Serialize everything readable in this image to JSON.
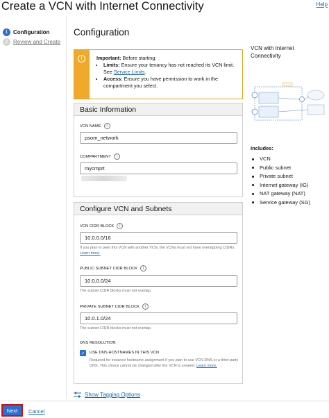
{
  "header": {
    "title": "Create a VCN with Internet Connectivity",
    "help_label": "Help"
  },
  "steps": [
    {
      "number": "1",
      "label": "Configuration",
      "state": "active"
    },
    {
      "number": "2",
      "label": "Review and Create",
      "state": "inactive"
    }
  ],
  "page": {
    "section_title": "Configuration"
  },
  "warning": {
    "icon": "info-icon",
    "heading": "Important:",
    "heading_rest": " Before starting:",
    "items": [
      {
        "bold": "Limits:",
        "text": " Ensure your tenancy has not reached its VCN limit. See ",
        "link": "Service Limits",
        "after": "."
      },
      {
        "bold": "Access:",
        "text": " Ensure you have permission to work in the compartment you select."
      }
    ]
  },
  "basic_info": {
    "title": "Basic Information",
    "vcn_name_label": "VCN NAME",
    "vcn_name_value": "psom_network",
    "compartment_label": "COMPARTMENT",
    "compartment_value": "mycmprt"
  },
  "vcn_config": {
    "title": "Configure VCN and Subnets",
    "vcn_cidr_label": "VCN CIDR BLOCK",
    "vcn_cidr_value": "10.0.0.0/16",
    "vcn_cidr_helper": "If you plan to peer this VCN with another VCN, the VCNs must not have overlapping CIDRs. ",
    "vcn_cidr_helper_link": "Learn more.",
    "public_cidr_label": "PUBLIC SUBNET CIDR BLOCK",
    "public_cidr_value": "10.0.0.0/24",
    "public_cidr_helper": "The subnet CIDR blocks must not overlap.",
    "private_cidr_label": "PRIVATE SUBNET CIDR BLOCK",
    "private_cidr_value": "10.0.1.0/24",
    "private_cidr_helper": "The subnet CIDR blocks must not overlap.",
    "dns_section_label": "DNS RESOLUTION",
    "dns_checkbox_label": "USE DNS HOSTNAMES IN THIS VCN",
    "dns_checked": true,
    "dns_helper": "Required for instance hostname assignment if you plan to use VCN DNS or a third-party DNS. This choice cannot be changed after the VCN is created. ",
    "dns_helper_link": "Learn more."
  },
  "tagging": {
    "label": "Show Tagging Options"
  },
  "footer": {
    "next_label": "Next",
    "cancel_label": "Cancel"
  },
  "sidebar": {
    "diagram_title": "VCN with Internet Connectivity",
    "includes_title": "Includes:",
    "includes": [
      "VCN",
      "Public subnet",
      "Private subnet",
      "Internet gateway (IG)",
      "NAT gateway (NAT)",
      "Service gateway (SG)"
    ]
  },
  "colors": {
    "primary": "#2a6fd6",
    "link": "#0f6bb4",
    "warning": "#f0a92a",
    "focus_outline": "#d01010"
  }
}
